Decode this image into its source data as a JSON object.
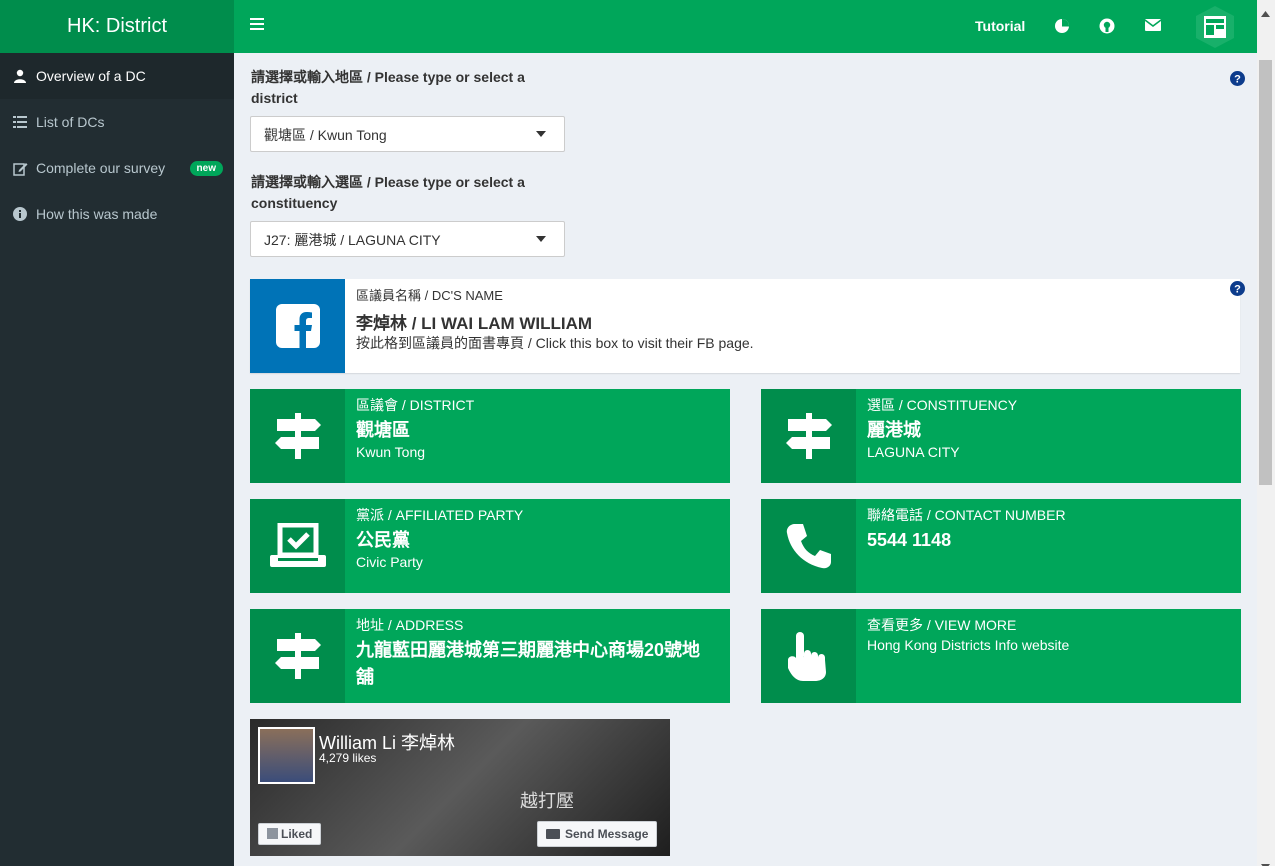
{
  "sidebar": {
    "brand": "HK: District",
    "items": [
      {
        "label": "Overview of a DC",
        "icon": "user-icon",
        "active": true
      },
      {
        "label": "List of DCs",
        "icon": "list-icon"
      },
      {
        "label": "Complete our survey",
        "icon": "edit-icon",
        "badge": "new"
      },
      {
        "label": "How this was made",
        "icon": "info-icon"
      }
    ]
  },
  "header": {
    "tutorial_label": "Tutorial",
    "icons": [
      "pie-chart-icon",
      "github-icon",
      "envelope-icon"
    ]
  },
  "main": {
    "district_label": "請選擇或輸入地區 / Please type or select a district",
    "district_value": "觀塘區 / Kwun Tong",
    "constituency_label": "請選擇或輸入選區 / Please type or select a constituency",
    "constituency_value": "J27: 麗港城 / LAGUNA CITY",
    "dc": {
      "title": "區議員名稱 / DC'S NAME",
      "name": "李焯林 / LI WAI LAM WILLIAM",
      "hint": "按此格到區議員的面書專頁 / Click this box to visit their FB page."
    },
    "boxes": {
      "district": {
        "key": "區議會 / DISTRICT",
        "value": "觀塘區",
        "sub": "Kwun Tong"
      },
      "constituency": {
        "key": "選區 / CONSTITUENCY",
        "value": "麗港城",
        "sub": "LAGUNA CITY"
      },
      "party": {
        "key": "黨派 / AFFILIATED PARTY",
        "value": "公民黨",
        "sub": "Civic Party"
      },
      "contact": {
        "key": "聯絡電話 / CONTACT NUMBER",
        "value": "5544 1148"
      },
      "address": {
        "key": "地址 / ADDRESS",
        "value": "九龍藍田麗港城第三期麗港中心商場20號地舖"
      },
      "viewmore": {
        "key": "查看更多 / VIEW MORE",
        "value": "Hong Kong Districts Info website"
      }
    },
    "fb": {
      "name": "William Li 李焯林",
      "likes": "4,279 likes",
      "slogan": "越打壓",
      "liked_label": "Liked",
      "send_label": "Send Message"
    }
  },
  "colors": {
    "green": "#00a65a",
    "dark_green": "#008d4c",
    "sidebar": "#222d32",
    "fb_blue": "#0073b7"
  }
}
